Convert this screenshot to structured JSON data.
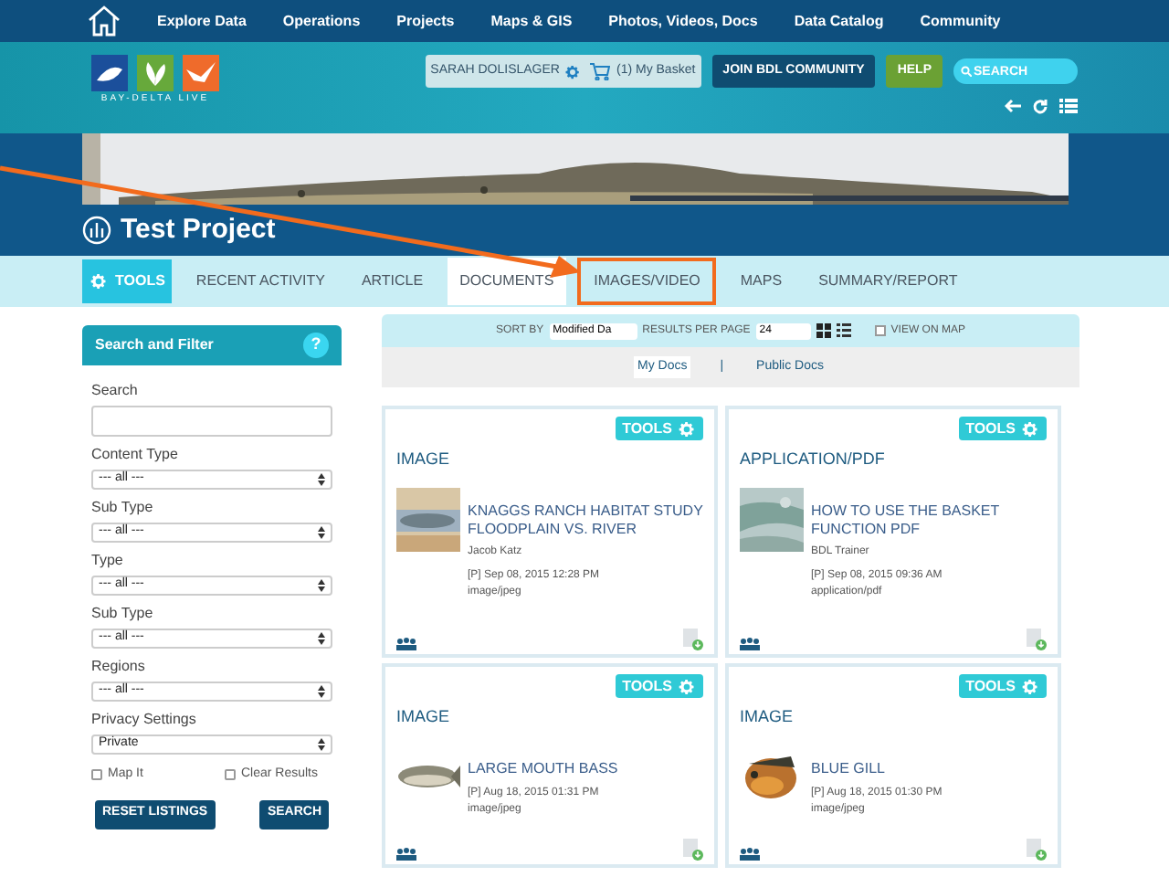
{
  "nav": {
    "items": [
      "Explore Data",
      "Operations",
      "Projects",
      "Maps & GIS",
      "Photos, Videos, Docs",
      "Data Catalog",
      "Community"
    ]
  },
  "header": {
    "logo_text": "BAY-DELTA LIVE",
    "user": "SARAH DOLISLAGER",
    "basket": "(1) My Basket",
    "join": "JOIN BDL COMMUNITY",
    "help": "HELP",
    "search_placeholder": "SEARCH"
  },
  "project": {
    "title": "Test Project"
  },
  "tabs": [
    {
      "label": "TOOLS",
      "kind": "tools",
      "selected": false,
      "highlighted": false
    },
    {
      "label": "RECENT ACTIVITY",
      "kind": "tab",
      "selected": false,
      "highlighted": false
    },
    {
      "label": "ARTICLE",
      "kind": "tab",
      "selected": false,
      "highlighted": false
    },
    {
      "label": "DOCUMENTS",
      "kind": "tab",
      "selected": true,
      "highlighted": false
    },
    {
      "label": "IMAGES/VIDEO",
      "kind": "tab",
      "selected": false,
      "highlighted": true
    },
    {
      "label": "MAPS",
      "kind": "tab",
      "selected": false,
      "highlighted": false
    },
    {
      "label": "SUMMARY/REPORT",
      "kind": "tab",
      "selected": false,
      "highlighted": false
    }
  ],
  "sidebar": {
    "title": "Search and Filter",
    "help": "?",
    "fields": [
      {
        "label": "Search",
        "kind": "text"
      },
      {
        "label": "Content Type",
        "kind": "select",
        "value": "--- all ---"
      },
      {
        "label": "Sub Type",
        "kind": "select",
        "value": "--- all ---"
      },
      {
        "label": "Type",
        "kind": "select",
        "value": "--- all ---"
      },
      {
        "label": "Sub Type",
        "kind": "select",
        "value": "--- all ---"
      },
      {
        "label": "Regions",
        "kind": "select",
        "value": "--- all ---"
      },
      {
        "label": "Privacy Settings",
        "kind": "select",
        "value": "Private"
      }
    ],
    "checkboxes": [
      {
        "label": "Map It",
        "checked": false
      },
      {
        "label": "Clear Results",
        "checked": false
      }
    ],
    "buttons": [
      "RESET LISTINGS",
      "SEARCH"
    ]
  },
  "toolbar": {
    "sort_label": "SORT BY",
    "sort_value": "Modified Da",
    "per_page_label": "RESULTS PER PAGE",
    "per_page_value": "24",
    "view_on_map": {
      "label": "VIEW ON MAP",
      "checked": false
    }
  },
  "doc_tabs": [
    {
      "label": "My Docs",
      "selected": true
    },
    {
      "label": "Public Docs",
      "selected": false
    }
  ],
  "doc_tab_separator": "|",
  "cards": [
    {
      "tools": "TOOLS",
      "type": "IMAGE",
      "title": "KNAGGS RANCH HABITAT STUDY FLOODPLAIN VS. RIVER",
      "author": "Jacob Katz",
      "date": "[P] Sep 08, 2015 12:28 PM",
      "mime": "image/jpeg"
    },
    {
      "tools": "TOOLS",
      "type": "APPLICATION/PDF",
      "title": "HOW TO USE THE BASKET FUNCTION PDF",
      "author": "BDL Trainer",
      "date": "[P] Sep 08, 2015 09:36 AM",
      "mime": "application/pdf"
    },
    {
      "tools": "TOOLS",
      "type": "IMAGE",
      "title": "LARGE MOUTH BASS",
      "date": "[P] Aug 18, 2015 01:31 PM",
      "mime": "image/jpeg"
    },
    {
      "tools": "TOOLS",
      "type": "IMAGE",
      "title": "BLUE GILL",
      "date": "[P] Aug 18, 2015 01:30 PM",
      "mime": "image/jpeg"
    }
  ]
}
